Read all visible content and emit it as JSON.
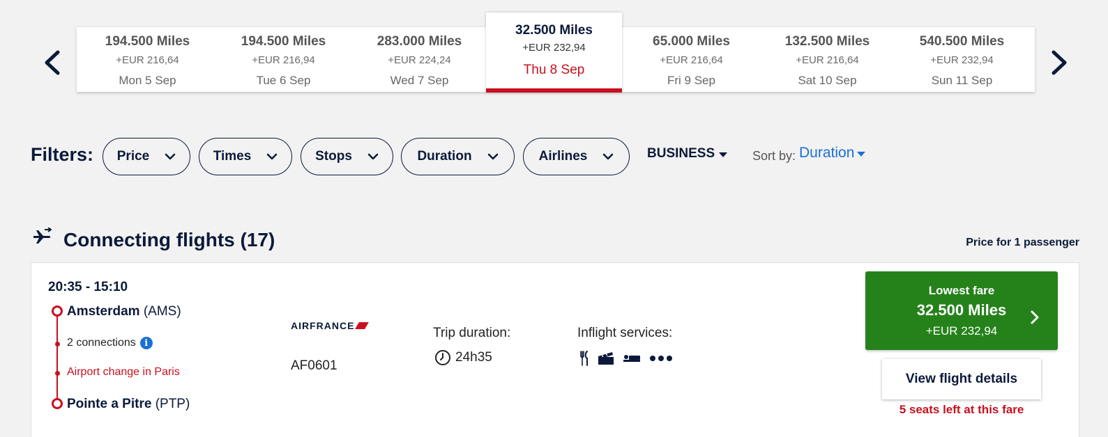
{
  "dates": [
    {
      "miles": "194.500 Miles",
      "eur": "+EUR 216,64",
      "day": "Mon 5 Sep"
    },
    {
      "miles": "194.500 Miles",
      "eur": "+EUR 216,94",
      "day": "Tue 6 Sep"
    },
    {
      "miles": "283.000 Miles",
      "eur": "+EUR 224,24",
      "day": "Wed 7 Sep"
    },
    {
      "miles": "32.500 Miles",
      "eur": "+EUR 232,94",
      "day": "Thu 8 Sep"
    },
    {
      "miles": "65.000 Miles",
      "eur": "+EUR 216,64",
      "day": "Fri 9 Sep"
    },
    {
      "miles": "132.500 Miles",
      "eur": "+EUR 216,64",
      "day": "Sat 10 Sep"
    },
    {
      "miles": "540.500 Miles",
      "eur": "+EUR 232,94",
      "day": "Sun 11 Sep"
    }
  ],
  "filters": {
    "label": "Filters:",
    "pills": [
      "Price",
      "Times",
      "Stops",
      "Duration",
      "Airlines"
    ],
    "cabin": "BUSINESS",
    "sort_label": "Sort by:",
    "sort_value": "Duration"
  },
  "section": {
    "title": "Connecting flights (17)",
    "price_for": "Price for 1 passenger"
  },
  "flight": {
    "times": "20:35 - 15:10",
    "origin_city": "Amsterdam",
    "origin_code": "(AMS)",
    "connections": "2 connections",
    "airport_change": "Airport change in Paris",
    "dest_city": "Pointe a Pitre",
    "dest_code": "(PTP)",
    "airline": "AIRFRANCE",
    "flight_number": "AF0601",
    "trip_label": "Trip duration:",
    "trip_value": "24h35",
    "services_label": "Inflight services:",
    "services_icons": [
      "cutlery-icon",
      "movie-icon",
      "bed-icon",
      "more-icon"
    ],
    "fare_label": "Lowest fare",
    "fare_miles": "32.500 Miles",
    "fare_eur": "+EUR 232,94",
    "details_label": "View flight details",
    "seats_left": "5 seats left at this fare"
  },
  "colors": {
    "navy": "#0b1a3a",
    "red": "#c8101e",
    "green": "#25821b",
    "blue": "#1a6fd6"
  }
}
